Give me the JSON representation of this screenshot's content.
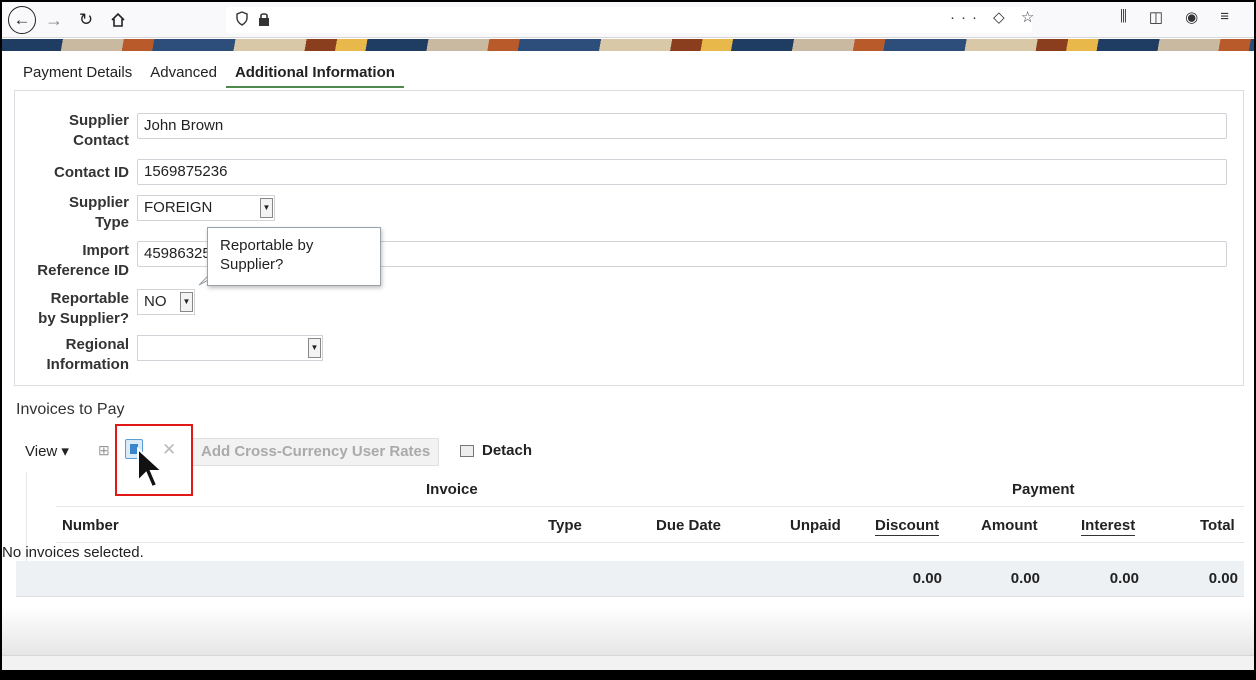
{
  "browser": {
    "back_icon": "arrow-left-icon",
    "forward_icon": "arrow-right-icon",
    "reload_icon": "reload-icon",
    "home_icon": "home-icon",
    "page_actions": "···",
    "bookmark_icon": "star-icon",
    "pocket_icon": "pocket-icon",
    "library_icon": "library-icon",
    "sidebar_icon": "sidebar-icon",
    "account_icon": "account-icon",
    "menu_icon": "hamburger-icon"
  },
  "tabs": [
    {
      "label": "Payment Details",
      "active": false
    },
    {
      "label": "Advanced",
      "active": false
    },
    {
      "label": "Additional Information",
      "active": true
    }
  ],
  "form": {
    "supplier_contact_label_1": "Supplier",
    "supplier_contact_label_2": "Contact",
    "supplier_contact_value": "John Brown",
    "contact_id_label": "Contact ID",
    "contact_id_value": "1569875236",
    "supplier_type_label_1": "Supplier",
    "supplier_type_label_2": "Type",
    "supplier_type_value": "FOREIGN",
    "import_ref_label_1": "Import",
    "import_ref_label_2": "Reference ID",
    "import_ref_value": "45986325",
    "reportable_label_1": "Reportable",
    "reportable_label_2": "by Supplier?",
    "reportable_value": "NO",
    "regional_label_1": "Regional",
    "regional_label_2": "Information",
    "regional_value": ""
  },
  "tooltip": {
    "line1": "Reportable by",
    "line2": "Supplier?"
  },
  "invoices": {
    "title": "Invoices to Pay",
    "view_label": "View ▾",
    "add_xrate_label": "Add Cross-Currency User Rates",
    "detach_label": "Detach",
    "group_invoice": "Invoice",
    "group_payment": "Payment",
    "columns": {
      "number": "Number",
      "type": "Type",
      "due_date": "Due Date",
      "unpaid": "Unpaid",
      "discount": "Discount",
      "amount": "Amount",
      "interest": "Interest",
      "total": "Total"
    },
    "empty_message": "No invoices selected.",
    "totals": {
      "discount": "0.00",
      "amount": "0.00",
      "interest": "0.00",
      "total": "0.00"
    }
  },
  "colors": {
    "active_tab_underline": "#4e8a4e",
    "highlight_box": "#e01818"
  }
}
